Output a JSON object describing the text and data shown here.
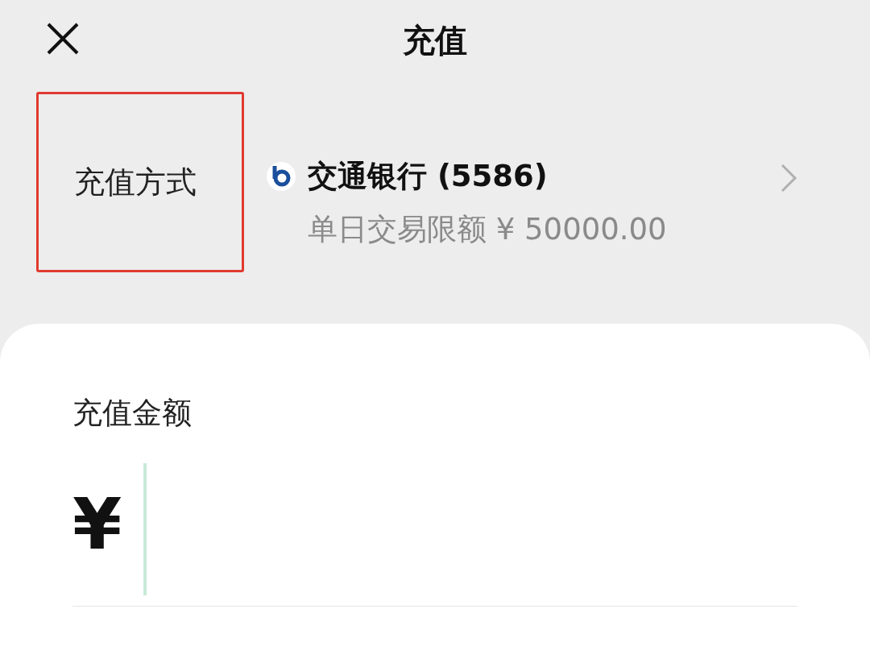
{
  "header": {
    "title": "充值"
  },
  "payment_method": {
    "label": "充值方式",
    "highlighted": true,
    "bank_name": "交通银行 (5586)",
    "limit": "单日交易限额 ¥ 50000.00"
  },
  "amount": {
    "label": "充值金额",
    "currency": "¥",
    "focused": true
  }
}
